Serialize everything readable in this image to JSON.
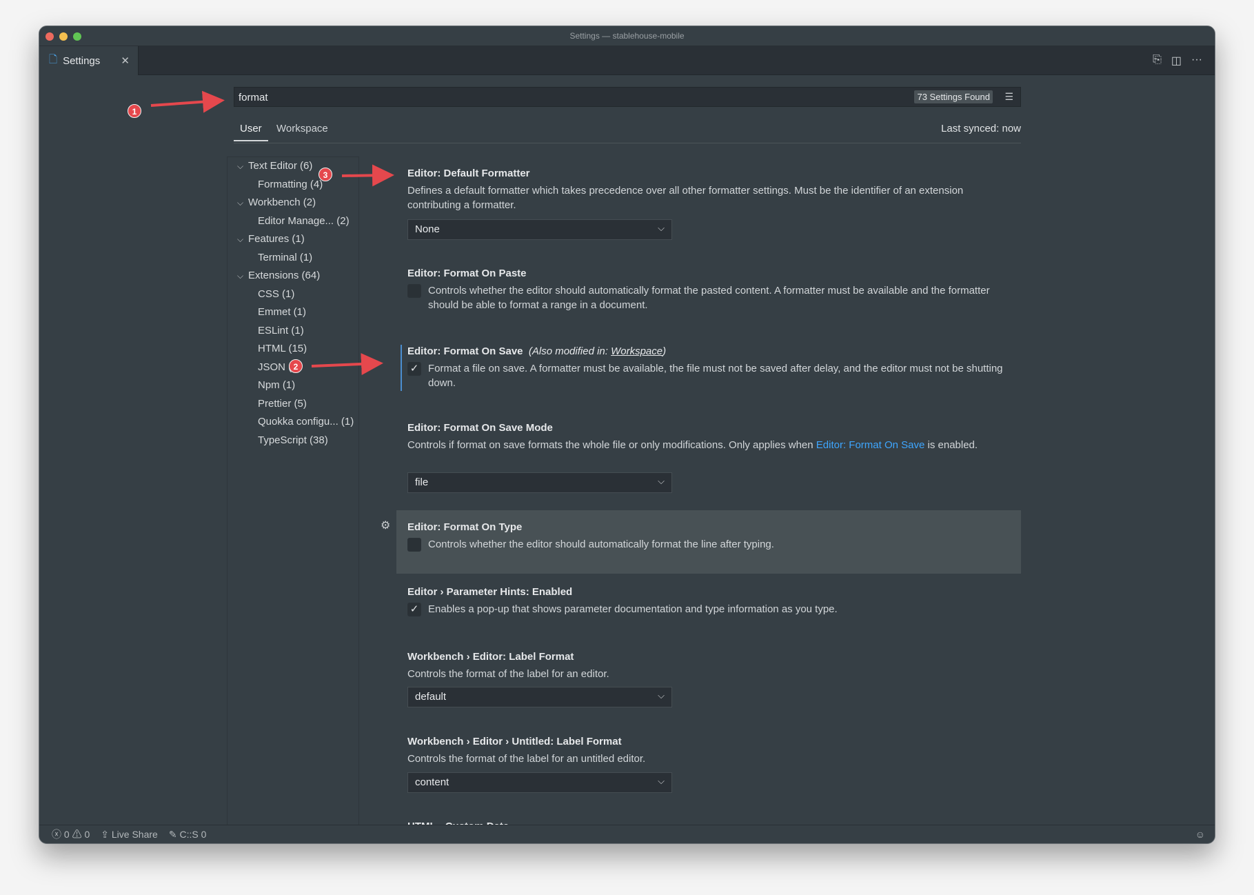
{
  "window": {
    "title": "Settings — stablehouse-mobile"
  },
  "tab": {
    "label": "Settings",
    "close": "✕",
    "icon": "file-icon"
  },
  "tab_actions": [
    "open-settings-json-icon",
    "split-editor-icon",
    "more-actions-icon"
  ],
  "search": {
    "value": "format",
    "results": "73 Settings Found",
    "clear_icon": "clear-filter-icon"
  },
  "scope_tabs": {
    "user": "User",
    "workspace": "Workspace",
    "active": "User",
    "last_synced": "Last synced: now"
  },
  "toc": [
    {
      "label": "Text Editor (6)",
      "level": 0,
      "expanded": true
    },
    {
      "label": "Formatting (4)",
      "level": 1
    },
    {
      "label": "Workbench (2)",
      "level": 0,
      "expanded": true
    },
    {
      "label": "Editor Manage...   (2)",
      "level": 1
    },
    {
      "label": "Features (1)",
      "level": 0,
      "expanded": true
    },
    {
      "label": "Terminal (1)",
      "level": 1
    },
    {
      "label": "Extensions (64)",
      "level": 0,
      "expanded": true
    },
    {
      "label": "CSS (1)",
      "level": 1
    },
    {
      "label": "Emmet (1)",
      "level": 1
    },
    {
      "label": "ESLint (1)",
      "level": 1
    },
    {
      "label": "HTML (15)",
      "level": 1
    },
    {
      "label": "JSON (1)",
      "level": 1
    },
    {
      "label": "Npm (1)",
      "level": 1
    },
    {
      "label": "Prettier (5)",
      "level": 1
    },
    {
      "label": "Quokka configu... (1)",
      "level": 1
    },
    {
      "label": "TypeScript (38)",
      "level": 1
    }
  ],
  "settings": {
    "default_formatter": {
      "title": "Editor: Default Formatter",
      "desc": "Defines a default formatter which takes precedence over all other formatter settings. Must be the identifier of an extension contributing a formatter.",
      "value": "None"
    },
    "format_on_paste": {
      "title": "Editor: Format On Paste",
      "desc": "Controls whether the editor should automatically format the pasted content. A formatter must be available and the formatter should be able to format a range in a document.",
      "checked": false
    },
    "format_on_save": {
      "title": "Editor: Format On Save",
      "modified_prefix": "(Also modified in: ",
      "modified_link": "Workspace",
      "modified_suffix": ")",
      "desc": "Format a file on save. A formatter must be available, the file must not be saved after delay, and the editor must not be shutting down.",
      "checked": true
    },
    "format_on_save_mode": {
      "title": "Editor: Format On Save Mode",
      "desc_pre": "Controls if format on save formats the whole file or only modifications. Only applies when ",
      "desc_link": "Editor: Format On Save",
      "desc_post": " is enabled.",
      "value": "file"
    },
    "format_on_type": {
      "title": "Editor: Format On Type",
      "desc": "Controls whether the editor should automatically format the line after typing.",
      "checked": false
    },
    "parameter_hints": {
      "title": "Editor › Parameter Hints: Enabled",
      "desc": "Enables a pop-up that shows parameter documentation and type information as you type.",
      "checked": true
    },
    "label_format": {
      "title": "Workbench › Editor: Label Format",
      "desc": "Controls the format of the label for an editor.",
      "value": "default"
    },
    "untitled_label_format": {
      "title": "Workbench › Editor › Untitled: Label Format",
      "desc": "Controls the format of the label for an untitled editor.",
      "value": "content"
    },
    "html_custom_data": {
      "title": "HTML › Custom Data"
    }
  },
  "status": {
    "errors": "0",
    "warnings": "0",
    "live_share": "Live Share",
    "cs": "C::S 0"
  },
  "annotations": [
    "1",
    "2",
    "3"
  ],
  "colors": {
    "annotation": "#e5484d",
    "link": "#3ea6ff",
    "background": "#363f45",
    "modified_bar": "#4b8ed0"
  }
}
